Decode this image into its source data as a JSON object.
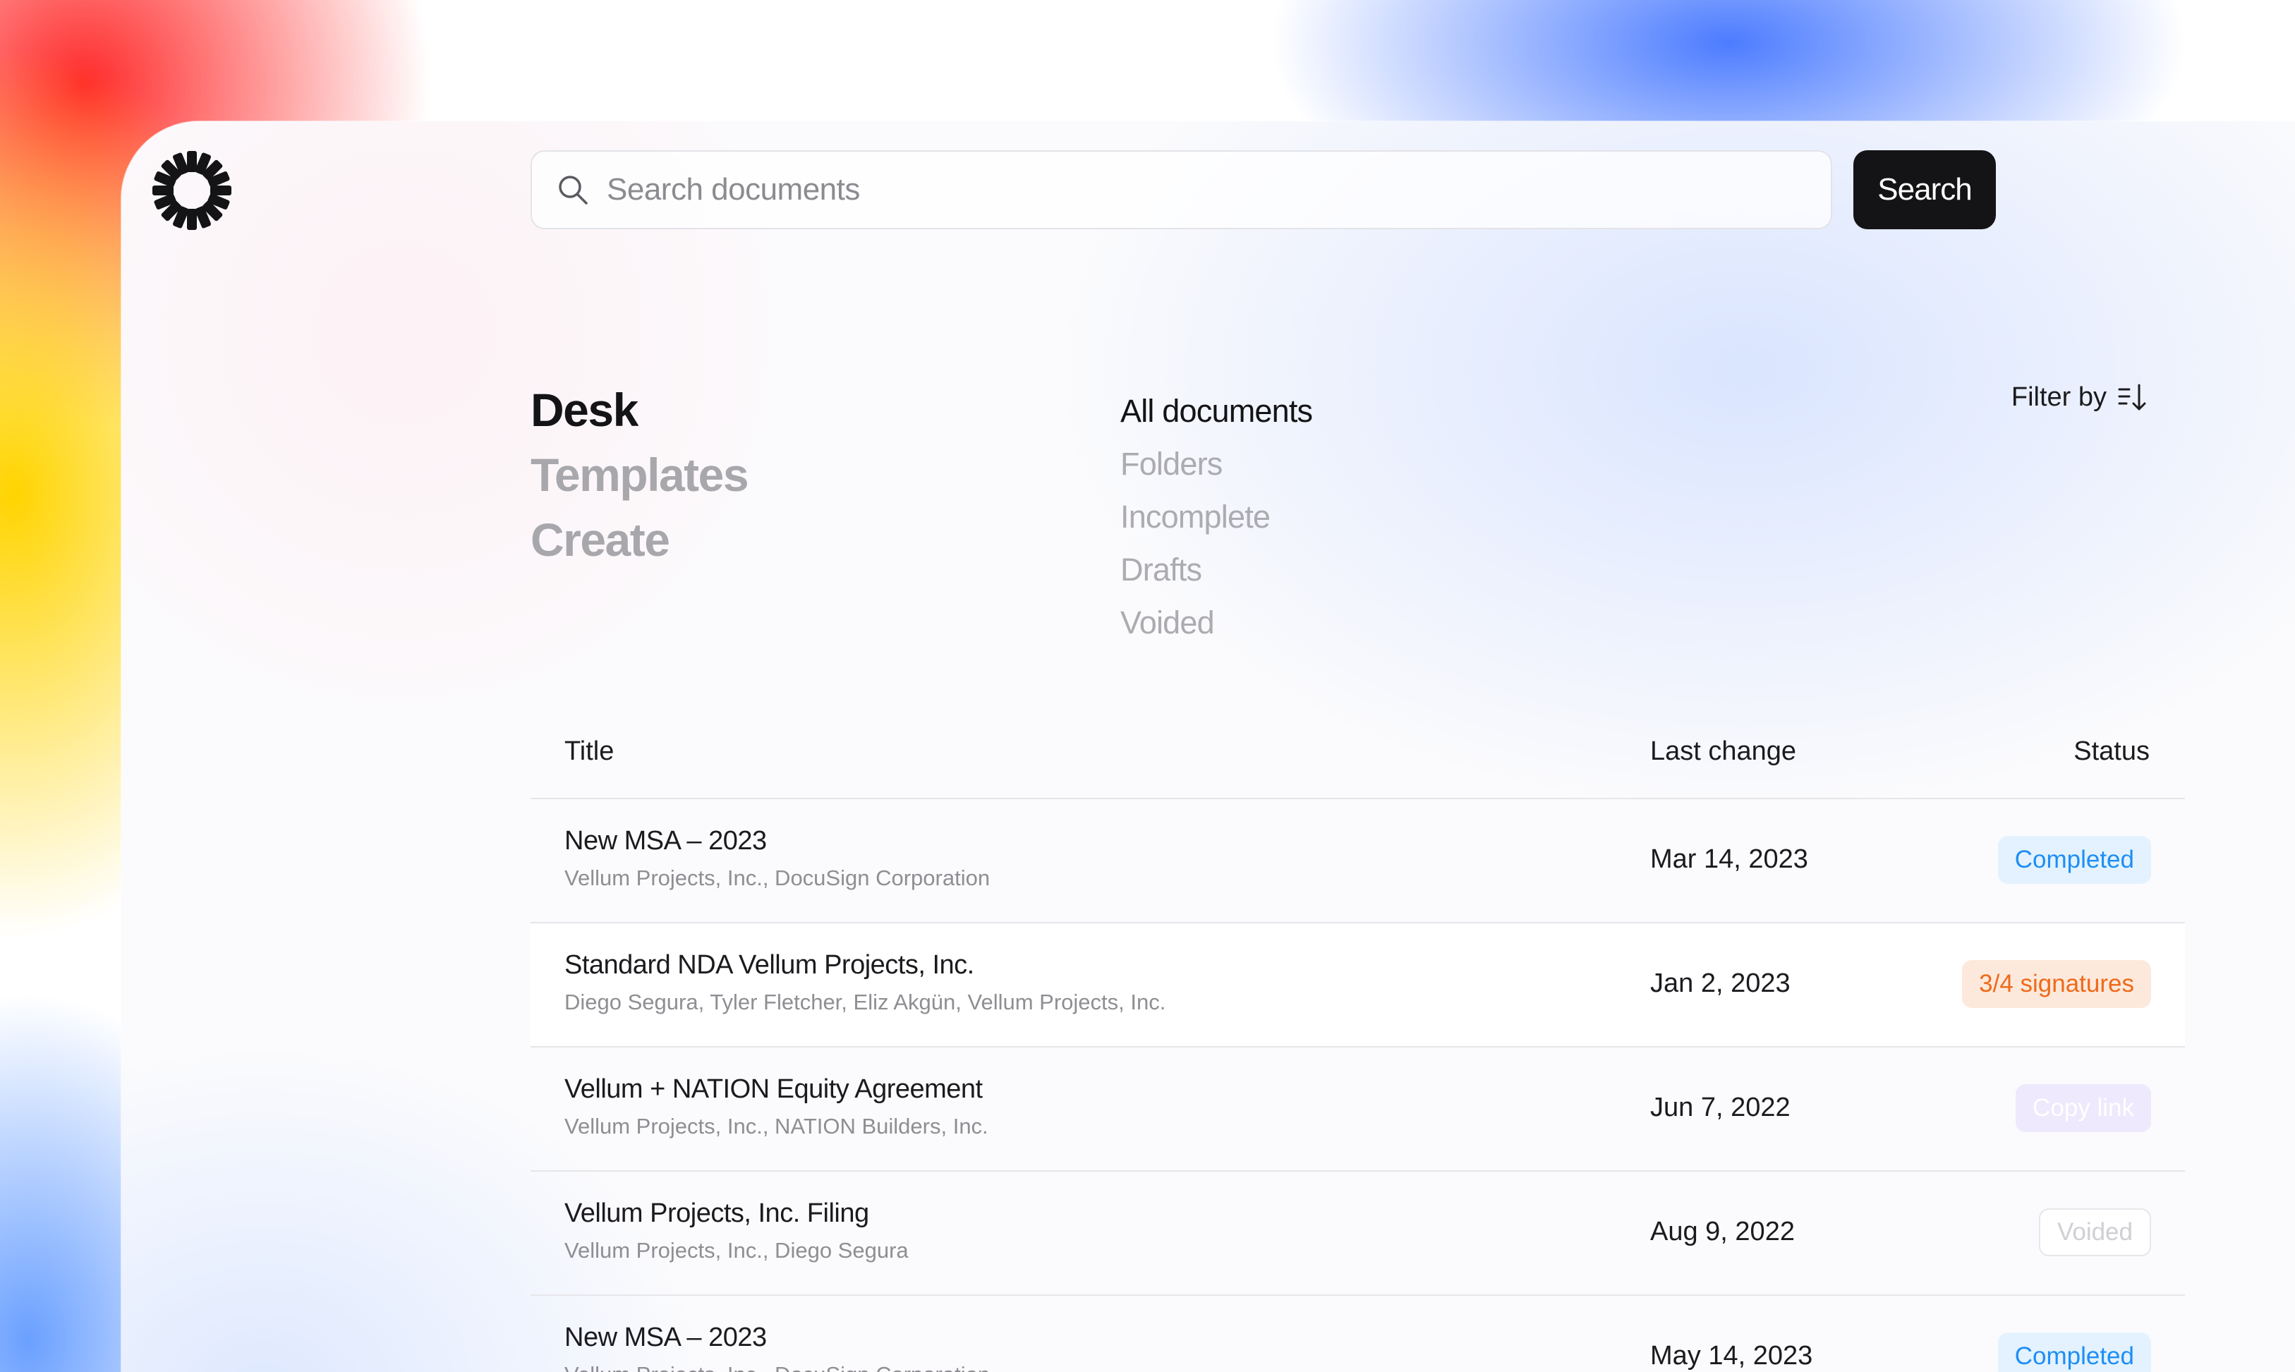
{
  "search": {
    "placeholder": "Search documents",
    "button_label": "Search"
  },
  "main_nav": {
    "items": [
      {
        "label": "Desk",
        "active": true
      },
      {
        "label": "Templates",
        "active": false
      },
      {
        "label": "Create",
        "active": false
      }
    ]
  },
  "sub_nav": {
    "items": [
      {
        "label": "All documents",
        "active": true
      },
      {
        "label": "Folders",
        "active": false
      },
      {
        "label": "Incomplete",
        "active": false
      },
      {
        "label": "Drafts",
        "active": false
      },
      {
        "label": "Voided",
        "active": false
      }
    ]
  },
  "filter": {
    "label": "Filter by",
    "icon": "sort-descending-icon"
  },
  "table": {
    "headers": {
      "title": "Title",
      "last_change": "Last change",
      "status": "Status"
    },
    "rows": [
      {
        "title": "New MSA – 2023",
        "parties": "Vellum Projects, Inc., DocuSign Corporation",
        "date": "Mar 14, 2023",
        "status": "Completed",
        "status_type": "completed"
      },
      {
        "title": "Standard NDA Vellum Projects, Inc.",
        "parties": "Diego Segura, Tyler Fletcher, Eliz Akgün, Vellum Projects, Inc.",
        "date": "Jan 2, 2023",
        "status": "3/4 signatures",
        "status_type": "signatures"
      },
      {
        "title": "Vellum + NATION Equity Agreement",
        "parties": "Vellum Projects, Inc., NATION Builders, Inc.",
        "date": "Jun 7, 2022",
        "status": "Copy link",
        "status_type": "copylink"
      },
      {
        "title": "Vellum Projects, Inc. Filing",
        "parties": "Vellum Projects, Inc., Diego Segura",
        "date": "Aug 9, 2022",
        "status": "Voided",
        "status_type": "voided"
      },
      {
        "title": "New MSA – 2023",
        "parties": "Vellum Projects, Inc., DocuSign Corporation",
        "date": "May 14, 2023",
        "status": "Completed",
        "status_type": "completed"
      }
    ]
  },
  "colors": {
    "completed": "#1e8ef5",
    "signatures": "#ef6a1a",
    "copy_link": "#eee9fd",
    "primary_button": "#141416"
  }
}
